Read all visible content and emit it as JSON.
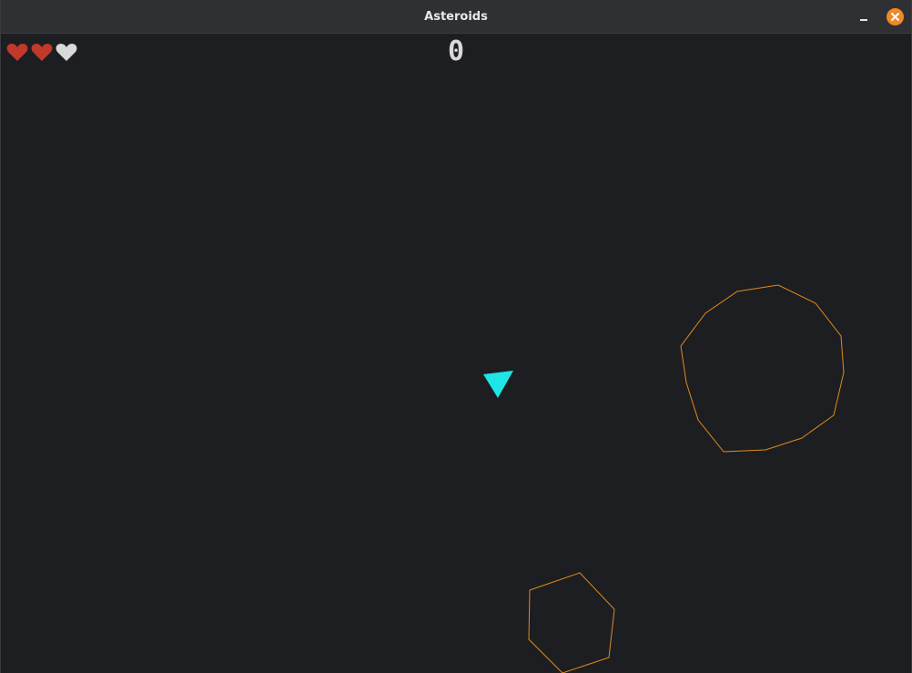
{
  "window": {
    "title": "Asteroids",
    "minimize_icon": "minimize-icon",
    "close_icon": "close-icon"
  },
  "hud": {
    "score": "0",
    "lives_total": 3,
    "lives_remaining": 2,
    "heart_full_color": "#c0392b",
    "heart_empty_color": "#d9d9d9"
  },
  "colors": {
    "background": "#1d1e21",
    "titlebar": "#2f3033",
    "ship": "#1ee6e6",
    "asteroid": "#e08a1e",
    "close_button": "#f08a24"
  }
}
